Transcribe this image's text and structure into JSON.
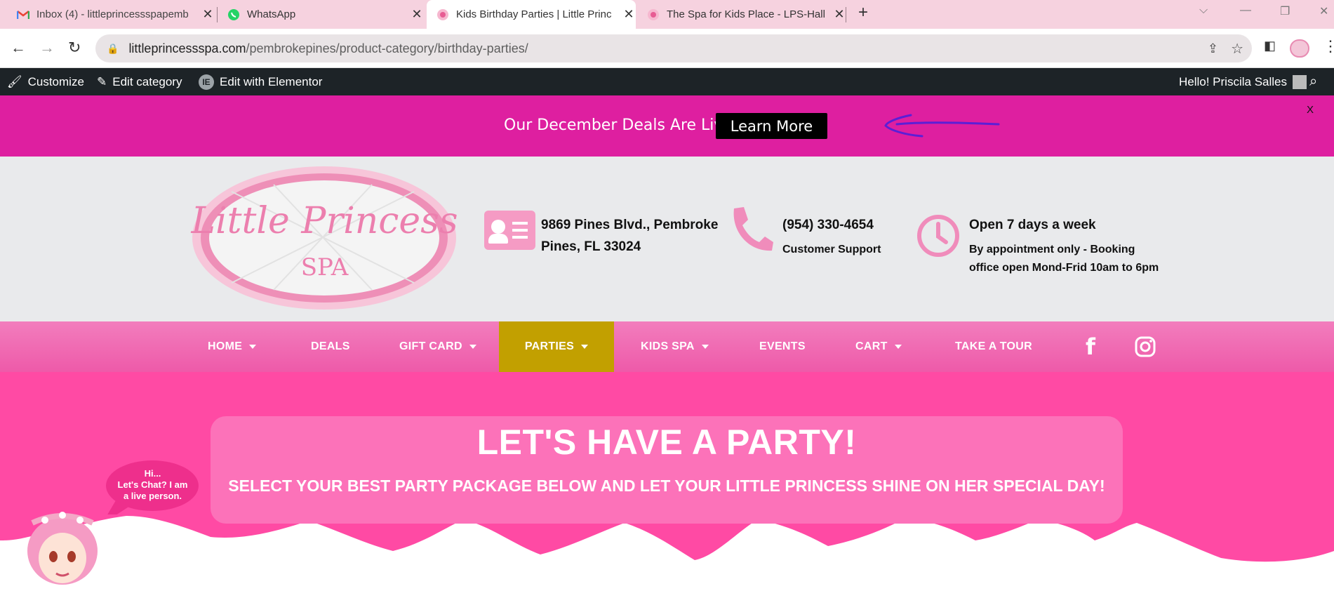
{
  "browser": {
    "tabs": [
      {
        "title": "Inbox (4) - littleprincessspapemb",
        "icon": "gmail-icon"
      },
      {
        "title": "WhatsApp",
        "icon": "whatsapp-icon"
      },
      {
        "title": "Kids Birthday Parties | Little Princ",
        "icon": "lps-icon"
      },
      {
        "title": "The Spa for Kids Place - LPS-Hall",
        "icon": "lps-icon"
      }
    ],
    "url_domain": "littleprincessspa.com",
    "url_path": "/pembrokepines/product-category/birthday-parties/"
  },
  "wp_admin": {
    "customize": "Customize",
    "edit_category": "Edit category",
    "edit_elementor": "Edit with Elementor",
    "greeting": "Hello! Priscila Salles"
  },
  "promo": {
    "text": "Our December Deals Are Live",
    "button": "Learn More",
    "close": "X"
  },
  "header": {
    "logo_line1": "Little Princess",
    "logo_line2": "SPA",
    "address_line1": "9869 Pines Blvd., Pembroke",
    "address_line2": "Pines, FL 33024",
    "phone": "(954) 330-4654",
    "phone_sub": "Customer Support",
    "hours": "Open 7 days a week",
    "hours_sub1": "By appointment only - Booking",
    "hours_sub2": "office open Mond-Frid 10am to 6pm"
  },
  "menu": {
    "home": "HOME",
    "deals": "DEALS",
    "gift_card": "GIFT CARD",
    "parties": "PARTIES",
    "kids_spa": "KIDS SPA",
    "events": "EVENTS",
    "cart": "CART",
    "take_tour": "TAKE A TOUR"
  },
  "hero": {
    "title": "LET'S HAVE A PARTY!",
    "subtitle": "SELECT YOUR BEST PARTY PACKAGE BELOW AND LET YOUR LITTLE PRINCESS SHINE ON HER SPECIAL DAY!",
    "chat_line1": "Hi...",
    "chat_line2": "Let's Chat? I am",
    "chat_line3": "a live person."
  },
  "colors": {
    "promo": "#de1fa0",
    "menu": "#ee5aa9",
    "menu_active": "#c2a000",
    "hero_card": "#fc72b9",
    "cloud": "#ff4aa4"
  }
}
